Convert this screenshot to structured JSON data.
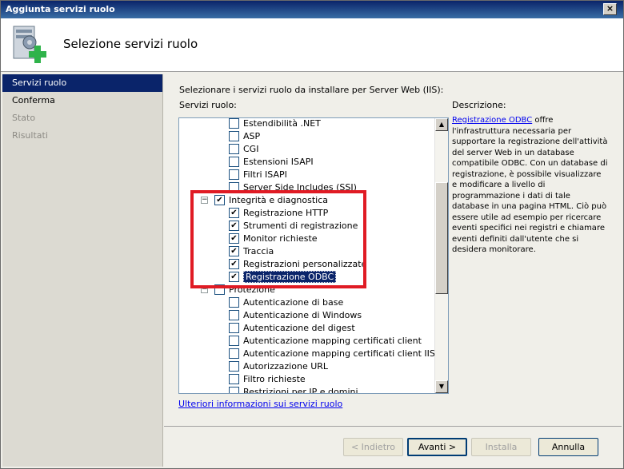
{
  "window": {
    "title": "Aggiunta servizi ruolo",
    "close_glyph": "×"
  },
  "header": {
    "title": "Selezione servizi ruolo",
    "icon": "server-add-icon"
  },
  "sidebar": {
    "items": [
      {
        "label": "Servizi ruolo",
        "state": "active"
      },
      {
        "label": "Conferma",
        "state": "normal"
      },
      {
        "label": "Stato",
        "state": "disabled"
      },
      {
        "label": "Risultati",
        "state": "disabled"
      }
    ]
  },
  "main": {
    "instruction": "Selezionare i servizi ruolo da installare per Server Web (IIS):",
    "list_label": "Servizi ruolo:",
    "description_label": "Descrizione:",
    "description_link": "Registrazione ODBC",
    "description_text": " offre l'infrastruttura necessaria per supportare la registrazione dell'attività del server Web in un database compatibile ODBC. Con un database di registrazione, è possibile visualizzare e modificare a livello di programmazione i dati di tale database in una pagina HTML. Ciò può essere utile ad esempio per ricercare eventi specifici nei registri e chiamare eventi definiti dall'utente che si desidera monitorare.",
    "tree": [
      {
        "label": "Estendibilità .NET",
        "checked": false,
        "level": 2
      },
      {
        "label": "ASP",
        "checked": false,
        "level": 2
      },
      {
        "label": "CGI",
        "checked": false,
        "level": 2
      },
      {
        "label": "Estensioni ISAPI",
        "checked": false,
        "level": 2
      },
      {
        "label": "Filtri ISAPI",
        "checked": false,
        "level": 2
      },
      {
        "label": "Server Side Includes (SSI)",
        "checked": false,
        "level": 2
      },
      {
        "label": "Integrità e diagnostica",
        "checked": true,
        "level": 1,
        "expander": "−"
      },
      {
        "label": "Registrazione HTTP",
        "checked": true,
        "level": 2
      },
      {
        "label": "Strumenti di registrazione",
        "checked": true,
        "level": 2
      },
      {
        "label": "Monitor richieste",
        "checked": true,
        "level": 2
      },
      {
        "label": "Traccia",
        "checked": true,
        "level": 2
      },
      {
        "label": "Registrazioni personalizzate",
        "checked": true,
        "level": 2
      },
      {
        "label": "Registrazione ODBC",
        "checked": true,
        "level": 2,
        "selected": true
      },
      {
        "label": "Protezione",
        "checked": false,
        "level": 1,
        "expander": "−"
      },
      {
        "label": "Autenticazione di base",
        "checked": false,
        "level": 2
      },
      {
        "label": "Autenticazione di Windows",
        "checked": false,
        "level": 2
      },
      {
        "label": "Autenticazione del digest",
        "checked": false,
        "level": 2
      },
      {
        "label": "Autenticazione mapping certificati client",
        "checked": false,
        "level": 2
      },
      {
        "label": "Autenticazione mapping certificati client IIS",
        "checked": false,
        "level": 2
      },
      {
        "label": "Autorizzazione URL",
        "checked": false,
        "level": 2
      },
      {
        "label": "Filtro richieste",
        "checked": false,
        "level": 2
      },
      {
        "label": "Restrizioni per IP e domini",
        "checked": false,
        "level": 2
      }
    ],
    "more_info_link": "Ulteriori informazioni sui servizi ruolo"
  },
  "buttons": {
    "back": "< Indietro",
    "next": "Avanti >",
    "install": "Installa",
    "cancel": "Annulla"
  },
  "colors": {
    "highlight_box": "#e01b24",
    "selection": "#0a246a"
  }
}
